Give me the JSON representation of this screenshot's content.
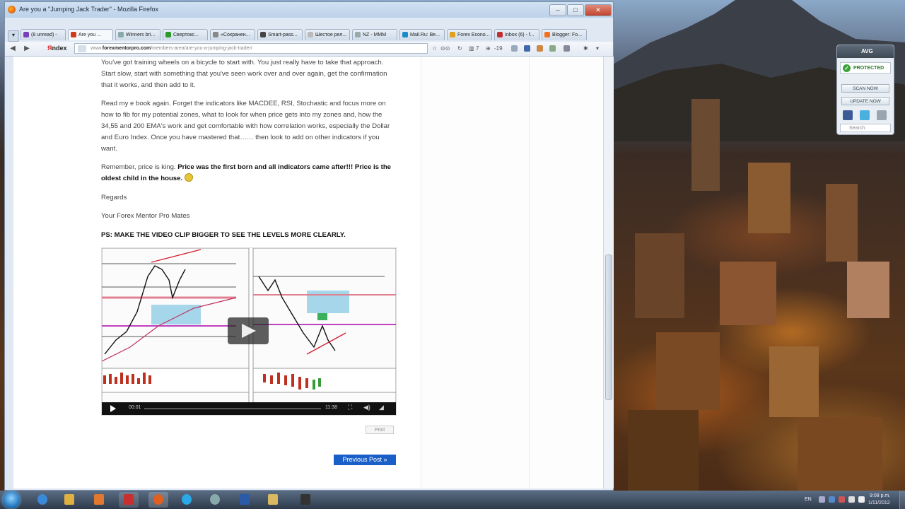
{
  "window": {
    "title": "Are you a \"Jumping Jack Trader\" - Mozilla Firefox",
    "min": "–",
    "max": "□",
    "close": "✕"
  },
  "tabs": [
    {
      "label": "(8 unread) -",
      "color": "#7a3fb8"
    },
    {
      "label": "Are you ...",
      "color": "#d23a1a",
      "active": true
    },
    {
      "label": "Winners bri...",
      "color": "#8aa"
    },
    {
      "label": "Свертокс...",
      "color": "#2a9a2a"
    },
    {
      "label": "«Сохранен...",
      "color": "#888"
    },
    {
      "label": "Smart-pass...",
      "color": "#444"
    },
    {
      "label": "Шестое рел...",
      "color": "#bbb"
    },
    {
      "label": "NZ - MMM",
      "color": "#9aa"
    },
    {
      "label": "Mail.Ru: Be...",
      "color": "#1a8ac8"
    },
    {
      "label": "Forex Econo...",
      "color": "#e0a020"
    },
    {
      "label": "Inbox (6) - f...",
      "color": "#c03030"
    },
    {
      "label": "Blogger: Fo...",
      "color": "#f07020"
    }
  ],
  "nav": {
    "yandex_y": "Я",
    "yandex_rest": "ndex",
    "url_prefix": "www.",
    "url_host": "forexmentorpro.com",
    "url_path": "/members-area/are-you-a-jumping-jack-trader/",
    "counter_a": "7",
    "counter_b": "-19"
  },
  "article": {
    "p1": "You've got training wheels on a bicycle to start with. You just really have to take that approach. Start slow, start with something that you've seen work over and over again, get the confirmation that it works, and then add to it.",
    "p2": "Read my e book again. Forget the indicators like MACDEE, RSI, Stochastic and focus more on how to fib for my potential zones, what to look for when price gets into my zones and, how the 34,55 and 200 EMA's work and get comfortable with how correlation works, especially the Dollar and Euro Index. Once you have mastered that…… then look to add on other indicators if you want.",
    "p3_intro": "Remember, price is king.",
    "p3_bold": "Price was the first born and all indicators came after!!! Price is the oldest child in the house.",
    "regards": "Regards",
    "signature": "Your Forex Mentor Pro Mates",
    "ps": "PS: MAKE THE VIDEO CLIP BIGGER TO SEE THE LEVELS MORE CLEARLY.",
    "video_time_current": "00:01",
    "video_time_total": "11:38",
    "print": "Print",
    "prev_post": "Previous Post »"
  },
  "avg": {
    "brand": "AVG",
    "status": "PROTECTED",
    "scan": "SCAN NOW",
    "update": "UPDATE NOW",
    "search_placeholder": "Search"
  },
  "taskbar": {
    "lang": "EN",
    "time": "9:08 p.m.",
    "date": "1/11/2012"
  }
}
